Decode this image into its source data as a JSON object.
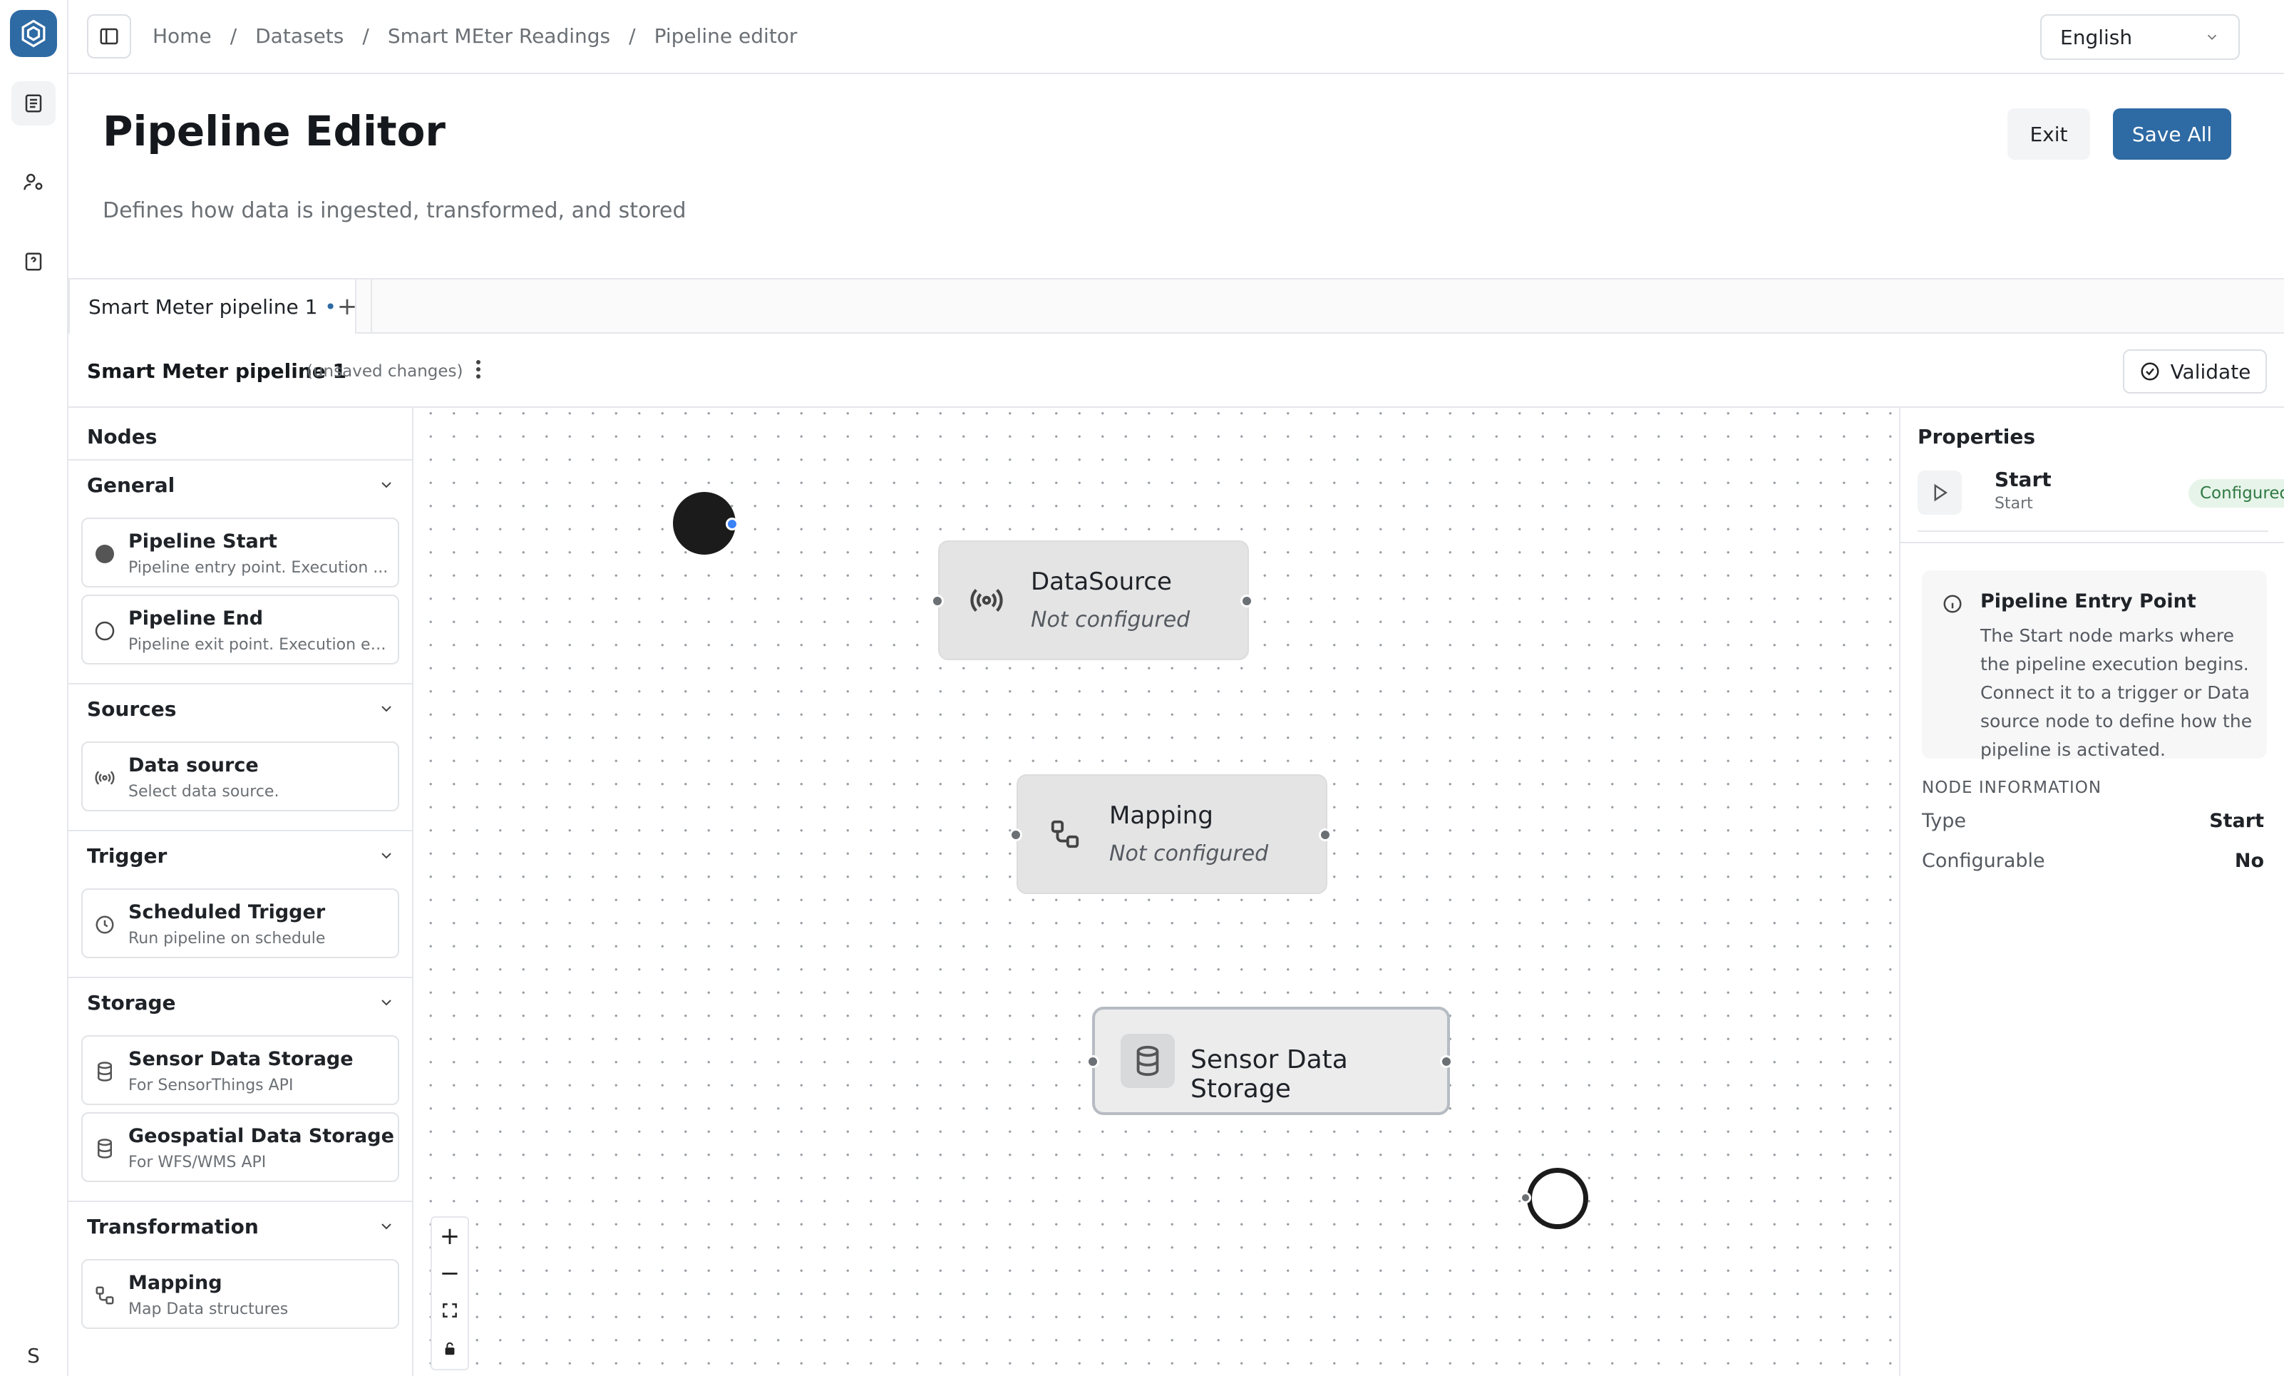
{
  "rail": {
    "avatar_initial": "S"
  },
  "breadcrumb": {
    "items": [
      "Home",
      "Datasets",
      "Smart MEter Readings",
      "Pipeline editor"
    ]
  },
  "language": {
    "selected": "English"
  },
  "header": {
    "title": "Pipeline Editor",
    "description": "Defines how data is ingested, transformed, and stored",
    "exit_label": "Exit",
    "save_label": "Save All"
  },
  "tabs": {
    "items": [
      {
        "label": "Smart Meter pipeline 1",
        "dirty_marker": "•"
      }
    ],
    "add_label": "+"
  },
  "toolbar": {
    "pipeline_name": "Smart Meter pipeline 1",
    "status": "(unsaved changes)",
    "validate_label": "Validate"
  },
  "palette": {
    "title": "Nodes",
    "sections": [
      {
        "title": "General",
        "items": [
          {
            "name": "Pipeline Start",
            "desc": "Pipeline entry point. Execution ..."
          },
          {
            "name": "Pipeline End",
            "desc": "Pipeline exit point. Execution en..."
          }
        ]
      },
      {
        "title": "Sources",
        "items": [
          {
            "name": "Data source",
            "desc": "Select data source."
          }
        ]
      },
      {
        "title": "Trigger",
        "items": [
          {
            "name": "Scheduled Trigger",
            "desc": "Run pipeline on schedule"
          }
        ]
      },
      {
        "title": "Storage",
        "items": [
          {
            "name": "Sensor Data Storage",
            "desc": "For SensorThings API"
          },
          {
            "name": "Geospatial Data Storage",
            "desc": "For WFS/WMS API"
          }
        ]
      },
      {
        "title": "Transformation",
        "items": [
          {
            "name": "Mapping",
            "desc": "Map Data structures"
          }
        ]
      }
    ]
  },
  "canvas": {
    "nodes": {
      "datasource": {
        "title": "DataSource",
        "status": "Not configured"
      },
      "mapping": {
        "title": "Mapping",
        "status": "Not configured"
      },
      "storage": {
        "title": "Sensor Data Storage"
      }
    },
    "zoom_controls": {
      "zoom_in": "+",
      "zoom_out": "−"
    }
  },
  "properties": {
    "title": "Properties",
    "node_name": "Start",
    "node_type_sub": "Start",
    "status_badge": "Configured",
    "info_title": "Pipeline Entry Point",
    "info_text": "The Start node marks where the pipeline execution begins. Connect it to a trigger or Data source node to define how the pipeline is activated.",
    "node_info_label": "NODE INFORMATION",
    "rows": [
      {
        "key": "Type",
        "value": "Start"
      },
      {
        "key": "Configurable",
        "value": "No"
      }
    ]
  },
  "colors": {
    "accent": "#2e6aa3",
    "configured_badge_bg": "#e7f4ea",
    "configured_badge_text": "#2f7a43",
    "handle_active": "#3b82f6"
  }
}
